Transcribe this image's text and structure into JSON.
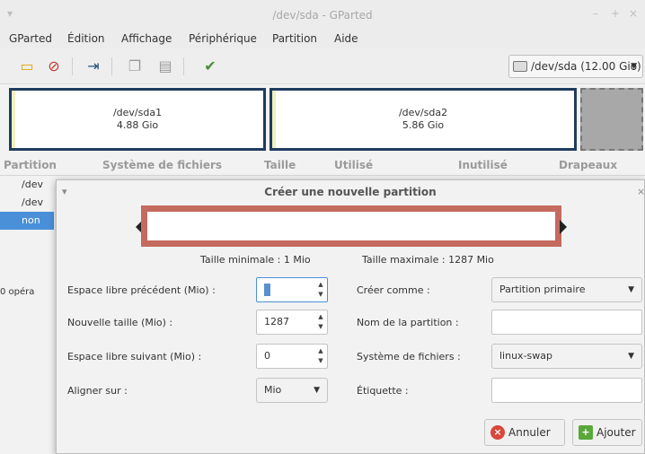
{
  "window": {
    "title": "/dev/sda - GParted",
    "controls": {
      "close": "×",
      "maximize": "+",
      "minimize": "–"
    }
  },
  "menu": [
    "GParted",
    "Édition",
    "Affichage",
    "Périphérique",
    "Partition",
    "Aide"
  ],
  "device_selector": {
    "label": "/dev/sda  (12.00 Gio)"
  },
  "disk_map": [
    {
      "name": "/dev/sda1",
      "size": "4.88 Gio"
    },
    {
      "name": "/dev/sda2",
      "size": "5.86 Gio"
    }
  ],
  "table": {
    "headers": [
      "Partition",
      "Système de fichiers",
      "Taille",
      "Utilisé",
      "Inutilisé",
      "Drapeaux"
    ],
    "rows": [
      "/dev",
      "/dev",
      "non"
    ]
  },
  "status": {
    "operations": "0 opéra"
  },
  "dialog": {
    "title": "Créer une nouvelle partition",
    "min_size": "Taille minimale : 1 Mio",
    "max_size": "Taille maximale : 1287 Mio",
    "fields": {
      "free_before_label": "Espace libre précédent (Mio) :",
      "free_before_value": "0",
      "new_size_label": "Nouvelle taille (Mio) :",
      "new_size_value": "1287",
      "free_after_label": "Espace libre suivant (Mio) :",
      "free_after_value": "0",
      "align_label": "Aligner sur :",
      "align_value": "Mio",
      "create_as_label": "Créer comme :",
      "create_as_value": "Partition primaire",
      "name_label": "Nom de la partition :",
      "name_value": "",
      "fs_label": "Système de fichiers :",
      "fs_value": "linux-swap",
      "tag_label": "Étiquette :",
      "tag_value": ""
    },
    "buttons": {
      "cancel": "Annuler",
      "add": "Ajouter"
    }
  },
  "colors": {
    "partition_border": "#1f3b5f",
    "size_bar": "#c46a5e",
    "accent": "#4a90d9"
  }
}
